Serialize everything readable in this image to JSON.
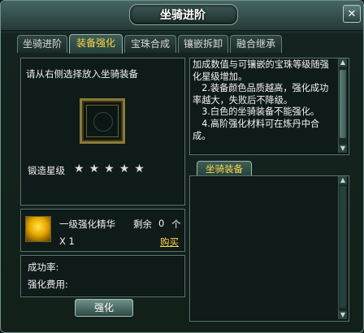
{
  "window": {
    "title": "坐骑进阶"
  },
  "tabs": [
    {
      "label": "坐骑进阶",
      "active": false
    },
    {
      "label": "装备强化",
      "active": true
    },
    {
      "label": "宝珠合成",
      "active": false
    },
    {
      "label": "镶嵌拆卸",
      "active": false
    },
    {
      "label": "融合继承",
      "active": false
    }
  ],
  "left": {
    "instruction": "请从右侧选择放入坐骑装备",
    "star_label": "锻造星级",
    "star_count": 5,
    "material": {
      "name": "一级强化精华",
      "quantity": "X 1",
      "remaining_label": "剩余",
      "remaining_value": "0",
      "remaining_unit": "个",
      "buy_label": "购买"
    },
    "success_rate_label": "成功率:",
    "cost_label": "强化费用:",
    "enhance_button": "强化"
  },
  "right": {
    "description_lines": [
      "加成数值与可镶嵌的宝珠等级随强化星级增加。",
      "　2.装备颜色品质越高，强化成功率越大，失败后不降级。",
      "　3.白色的坐骑装备不能强化。",
      "　4.高阶强化材料可在炼丹中合成。"
    ],
    "equipment_tab": "坐骑装备"
  },
  "colors": {
    "accent": "#ffd64a",
    "panel": "#0f1b19",
    "border": "#5b7672"
  }
}
